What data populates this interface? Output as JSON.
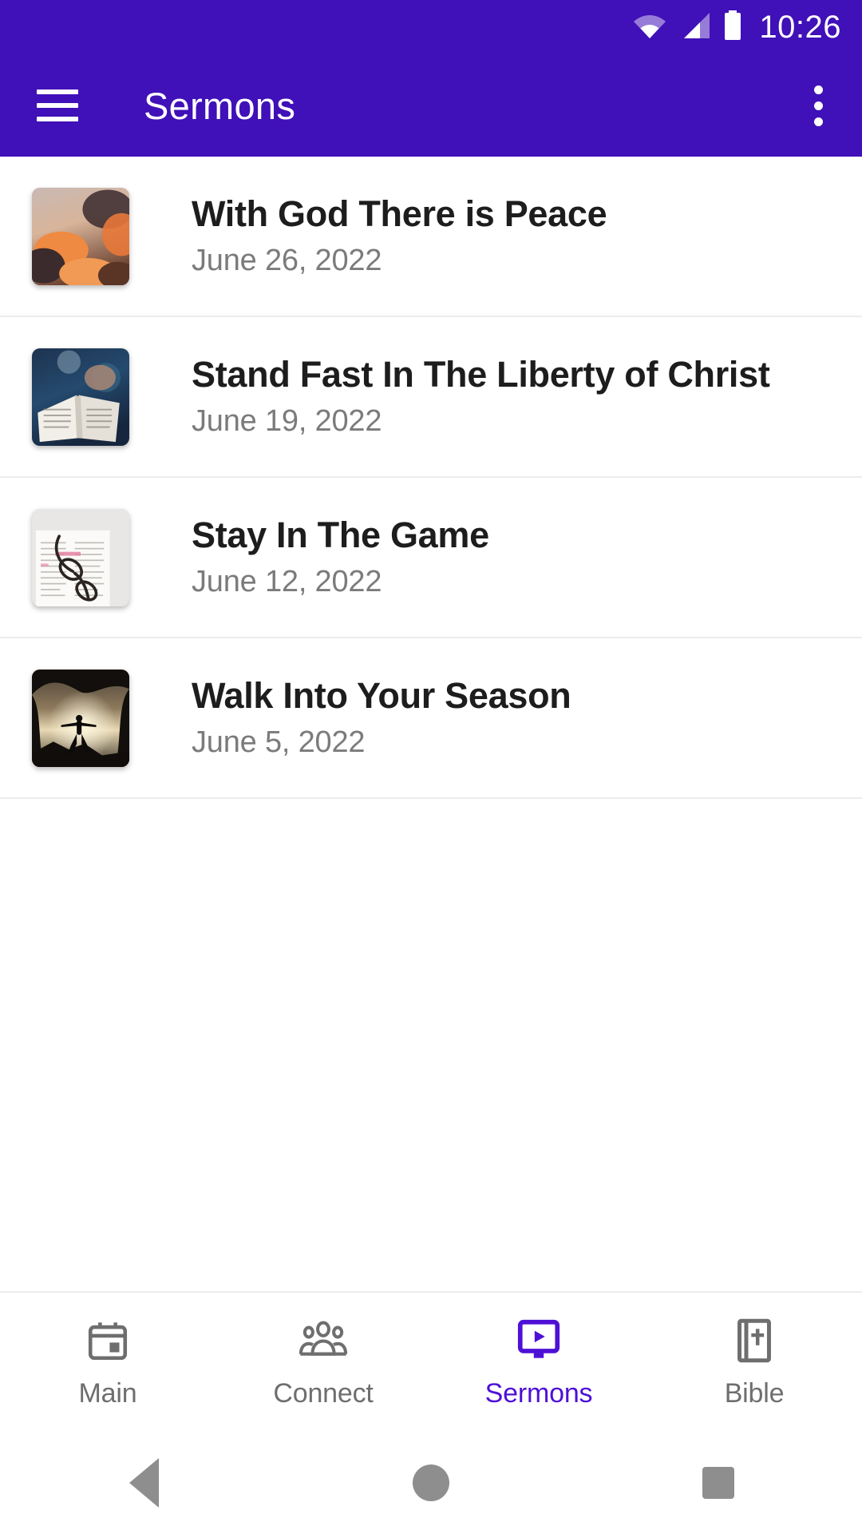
{
  "status_bar": {
    "time": "10:26",
    "icons": [
      "wifi-icon",
      "cellular-signal-icon",
      "battery-icon"
    ],
    "background_color": "#4010b8"
  },
  "app_bar": {
    "title": "Sermons",
    "menu_icon": "hamburger-menu-icon",
    "overflow_icon": "more-vertical-icon",
    "background_color": "#4010b8",
    "text_color": "#ffffff"
  },
  "sermons": [
    {
      "title": "With God There is Peace",
      "date": "June 26, 2022",
      "thumbnail": "orange-sunset-clouds"
    },
    {
      "title": "Stand Fast In The Liberty of Christ",
      "date": "June 19, 2022",
      "thumbnail": "open-bible-blue-background"
    },
    {
      "title": "Stay In The Game",
      "date": "June 12, 2022",
      "thumbnail": "eyeglasses-on-open-book"
    },
    {
      "title": "Walk Into Your Season",
      "date": "June 5, 2022",
      "thumbnail": "silhouette-on-cliff-at-sunset"
    }
  ],
  "tab_bar": {
    "active_color": "#4e10d6",
    "inactive_color": "#6e6e6e",
    "tabs": [
      {
        "label": "Main",
        "icon": "calendar-icon",
        "active": false
      },
      {
        "label": "Connect",
        "icon": "people-group-icon",
        "active": false
      },
      {
        "label": "Sermons",
        "icon": "video-monitor-play-icon",
        "active": true
      },
      {
        "label": "Bible",
        "icon": "bible-book-cross-icon",
        "active": false
      }
    ]
  },
  "system_nav": {
    "back": "back-triangle-icon",
    "home": "home-circle-icon",
    "recents": "recents-square-icon"
  }
}
